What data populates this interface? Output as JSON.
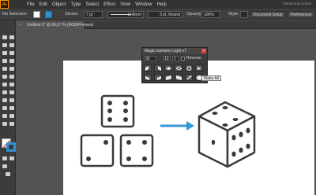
{
  "app": {
    "logo": "Ai"
  },
  "menubar": {
    "items": [
      "File",
      "Edit",
      "Object",
      "Type",
      "Select",
      "Effect",
      "View",
      "Window",
      "Help"
    ],
    "watermark": "Fotostrana.ru/club"
  },
  "controlbar": {
    "selection_label": "No Selection",
    "stroke_label": "Stroke:",
    "stroke_weight": "7 pt",
    "profile_value": "Uniform",
    "brush_value": "3 pt. Round",
    "opacity_label": "Opacity:",
    "opacity_value": "100%",
    "style_label": "Style:",
    "document_setup_label": "Document Setup",
    "preferences_label": "Preferences"
  },
  "document_tab": {
    "close_glyph": "×",
    "title": "Untitled-1* @ 66,67 % (RGB/Preview)"
  },
  "panel": {
    "title": "Magic Isometry Light v7",
    "close_glyph": "×",
    "angle_value": "30",
    "field2_value": "13",
    "field3_value": "1",
    "reverse_label": "Reverse",
    "tooltip": "Make All"
  },
  "colors": {
    "accent_blue": "#3399d6",
    "stroke_blue": "#2e92cf",
    "close_red": "#d83a3a",
    "ai_orange": "#ff9a00",
    "die_stroke": "#3a3a3a"
  },
  "icons": [
    "ai-logo-icon",
    "gear-icon",
    "close-icon",
    "arrow-right-icon",
    "die-front-icon",
    "die-isometric-icon",
    "wrench-icon",
    "make-all-icon"
  ]
}
